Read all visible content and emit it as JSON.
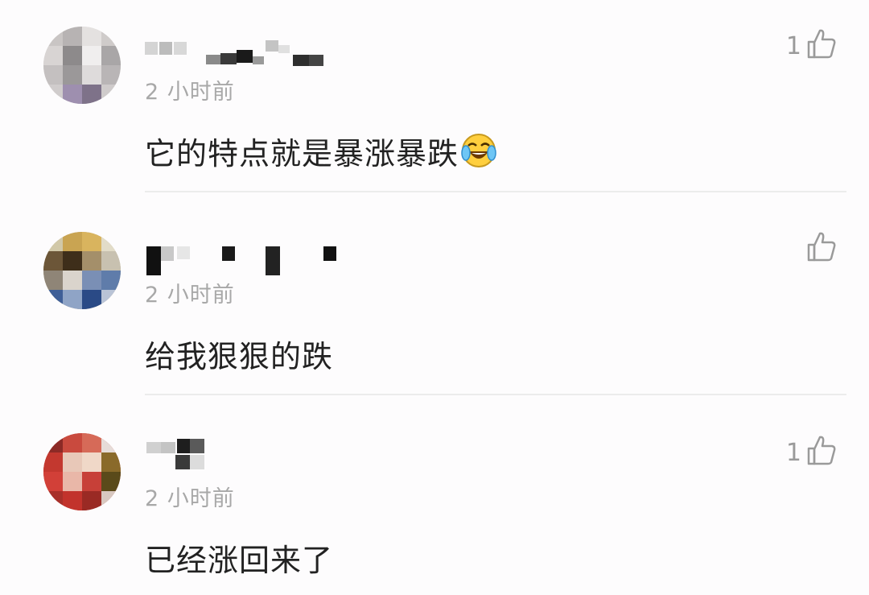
{
  "comments": [
    {
      "time": "2 小时前",
      "text": "它的特点就是暴涨暴跌",
      "emoji": "laughing-crying-emoji",
      "likes": "1"
    },
    {
      "time": "2 小时前",
      "text": "给我狠狠的跌",
      "likes": ""
    },
    {
      "time": "2 小时前",
      "text": "已经涨回来了",
      "likes": "1"
    }
  ],
  "icons": {
    "like": "thumbs-up-outline-icon"
  },
  "colors": {
    "background": "#fdfcfd",
    "text": "#222222",
    "muted": "#a8a8a8",
    "divider": "#ececec"
  }
}
